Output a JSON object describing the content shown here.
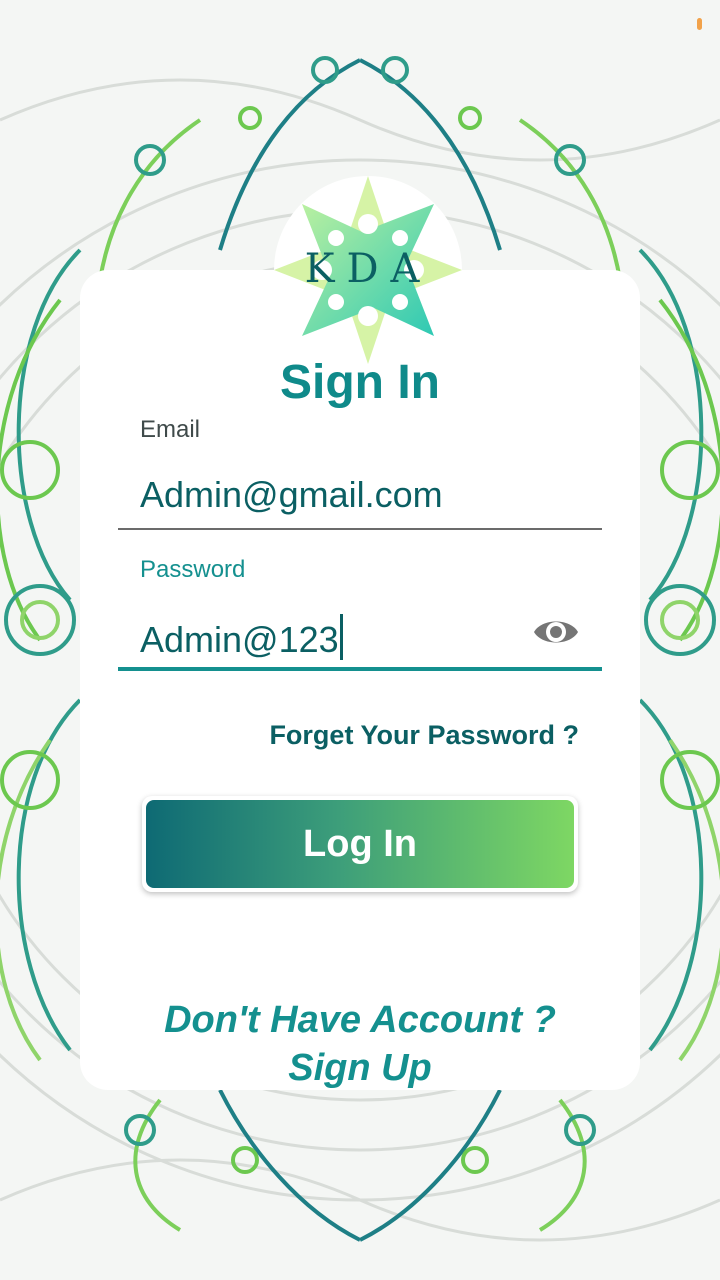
{
  "brand": {
    "logo_text": "KDA"
  },
  "signin": {
    "title": "Sign In",
    "email_label": "Email",
    "email_value": "Admin@gmail.com",
    "password_label": "Password",
    "password_value": "Admin@123",
    "forgot_label": "Forget Your Password ?",
    "login_label": "Log In",
    "no_account_label": "Don't Have Account ?",
    "signup_label": "Sign Up"
  },
  "icons": {
    "password_toggle": "eye-icon"
  },
  "colors": {
    "primary_teal": "#0f8a8a",
    "dark_teal": "#0b5f63",
    "gradient_start": "#0e6a74",
    "gradient_end": "#7ed763"
  }
}
